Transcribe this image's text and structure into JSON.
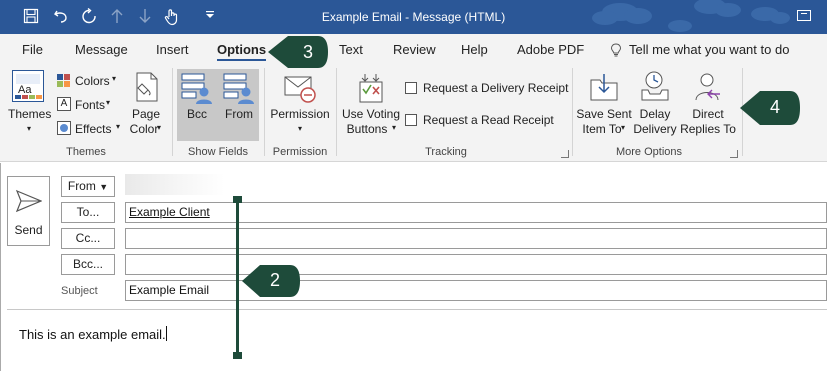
{
  "window": {
    "title": "Example Email  -  Message (HTML)"
  },
  "quick_access": {
    "save_icon": "save-icon",
    "undo_icon": "undo-icon",
    "redo_icon": "redo-icon",
    "up_icon": "arrow-up-icon",
    "down_icon": "arrow-down-icon",
    "touch_icon": "touch-mode-icon",
    "customize_icon": "customize-dropdown-icon"
  },
  "tabs": [
    "File",
    "Message",
    "Insert",
    "Options",
    "Text",
    "Review",
    "Help",
    "Adobe PDF"
  ],
  "active_tab": "Options",
  "tell_me": "Tell me what you want to do",
  "ribbon": {
    "themes": {
      "themes_btn": [
        "Themes"
      ],
      "colors": "Colors",
      "fonts": "Fonts",
      "effects": "Effects",
      "page_color": [
        "Page",
        "Color"
      ],
      "group_label": "Themes"
    },
    "show_fields": {
      "bcc": "Bcc",
      "from": "From",
      "group_label": "Show Fields"
    },
    "permission": {
      "permission_btn": "Permission",
      "group_label": "Permission"
    },
    "tracking": {
      "voting": [
        "Use Voting",
        "Buttons"
      ],
      "delivery_receipt": "Request a Delivery Receipt",
      "read_receipt": "Request a Read Receipt",
      "group_label": "Tracking"
    },
    "more_options": {
      "save_sent": [
        "Save Sent",
        "Item To"
      ],
      "delay": [
        "Delay",
        "Delivery"
      ],
      "direct": [
        "Direct",
        "Replies To"
      ],
      "group_label": "More Options"
    }
  },
  "compose": {
    "send": "Send",
    "from_btn": "From",
    "to_btn": "To...",
    "cc_btn": "Cc...",
    "bcc_btn": "Bcc...",
    "subject_label": "Subject",
    "to_value": "Example Client",
    "cc_value": "",
    "bcc_value": "",
    "subject_value": "Example Email",
    "body": "This is an example email."
  },
  "callouts": {
    "c2": "2",
    "c3": "3",
    "c4": "4"
  },
  "colors": {
    "title_bar": "#2b5797",
    "callout": "#1e4b3a",
    "ribbon_bg": "#f3f3f3"
  }
}
